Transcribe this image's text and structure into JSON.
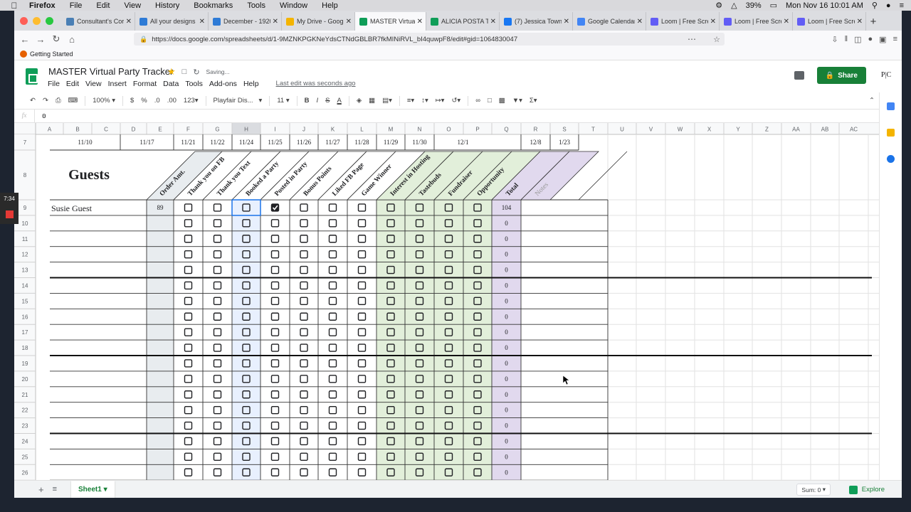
{
  "os_menubar": {
    "app": "Firefox",
    "menus": [
      "File",
      "Edit",
      "View",
      "History",
      "Bookmarks",
      "Tools",
      "Window",
      "Help"
    ],
    "battery": "39%",
    "datetime": "Mon Nov 16  10:01 AM"
  },
  "browser": {
    "tabs": [
      {
        "title": "Consultant's Cor",
        "color": "#4a7fb5",
        "active": false
      },
      {
        "title": "All your designs",
        "color": "#2e7bd6",
        "active": false
      },
      {
        "title": "December - 1920",
        "color": "#2e7bd6",
        "active": false
      },
      {
        "title": "My Drive - Googl",
        "color": "#f4b400",
        "active": false
      },
      {
        "title": "MASTER Virtual P",
        "color": "#0f9d58",
        "active": true
      },
      {
        "title": "ALICIA POSTA TH",
        "color": "#0f9d58",
        "active": false
      },
      {
        "title": "(7) Jessica Townl",
        "color": "#1877f2",
        "active": false
      },
      {
        "title": "Google Calendar",
        "color": "#4285f4",
        "active": false
      },
      {
        "title": "Loom | Free Scre",
        "color": "#625df5",
        "active": false
      },
      {
        "title": "Loom | Free Scre",
        "color": "#625df5",
        "active": false
      },
      {
        "title": "Loom | Free Scre",
        "color": "#625df5",
        "active": false
      }
    ],
    "url": "https://docs.google.com/spreadsheets/d/1-9MZNKPGKNeYdsCTNdGBLBR7fkMINiRVL_bI4quwpF8/edit#gid=1064830047",
    "bookmark": "Getting Started"
  },
  "doc": {
    "title": "MASTER Virtual Party Tracker",
    "status": "Saving...",
    "menus": [
      "File",
      "Edit",
      "View",
      "Insert",
      "Format",
      "Data",
      "Tools",
      "Add-ons",
      "Help"
    ],
    "last_edit": "Last edit was seconds ago",
    "share_label": "Share",
    "avatar_text": "P|C"
  },
  "toolbar": {
    "zoom": "100%",
    "currency": "$",
    "percent": "%",
    "dec_less": ".0",
    "dec_more": ".00",
    "more_formats": "123",
    "font": "Playfair Dis...",
    "font_size": "11",
    "bold": "B",
    "italic": "I",
    "strike": "S",
    "text_color": "A"
  },
  "formula_bar": {
    "fx": "fx",
    "value": "0"
  },
  "sheet": {
    "columns": [
      "A",
      "B",
      "C",
      "D",
      "E",
      "F",
      "G",
      "H",
      "I",
      "J",
      "K",
      "L",
      "M",
      "N",
      "O",
      "P",
      "Q",
      "R",
      "S",
      "T",
      "U",
      "V",
      "W",
      "X",
      "Y",
      "Z",
      "AA",
      "AB",
      "AC"
    ],
    "row_numbers": [
      "7",
      "8",
      "9",
      "10",
      "11",
      "12",
      "13",
      "14",
      "15",
      "16",
      "17",
      "18",
      "19",
      "20",
      "21",
      "22",
      "23",
      "24",
      "25",
      "26"
    ],
    "header_label": "Guests",
    "dates": [
      {
        "text": "11/10",
        "col": "B"
      },
      {
        "text": "11/17",
        "col": "E"
      },
      {
        "text": "11/21",
        "col": "F"
      },
      {
        "text": "11/22",
        "col": "G"
      },
      {
        "text": "11/24",
        "col": "H"
      },
      {
        "text": "11/25",
        "col": "I"
      },
      {
        "text": "11/26",
        "col": "J"
      },
      {
        "text": "11/27",
        "col": "K"
      },
      {
        "text": "11/28",
        "col": "L"
      },
      {
        "text": "11/29",
        "col": "M"
      },
      {
        "text": "11/30",
        "col": "N"
      },
      {
        "text": "12/1",
        "col": "OP"
      },
      {
        "text": "12/8",
        "col": "R"
      },
      {
        "text": "1/23",
        "col": "S"
      }
    ],
    "diagonal_headers": [
      "Order Amt.",
      "Thank you on FB",
      "Thank you Text",
      "Booked a Party",
      "Posted in Party",
      "Bonus Points",
      "Liked FB Page",
      "Game Winner",
      "Interest in Hosting",
      "Tastebuds",
      "Fundraiser",
      "Opportunity",
      "Total",
      "Notes"
    ],
    "guest_rows": [
      {
        "name": "Susie Guest",
        "order": "89",
        "checks": [
          false,
          false,
          false,
          true,
          false,
          false,
          false,
          false,
          false,
          false,
          false
        ],
        "total": "104"
      },
      {
        "name": "",
        "order": "",
        "checks": [],
        "total": "0"
      },
      {
        "name": "",
        "order": "",
        "checks": [],
        "total": "0"
      },
      {
        "name": "",
        "order": "",
        "checks": [],
        "total": "0"
      },
      {
        "name": "",
        "order": "",
        "checks": [],
        "total": "0"
      },
      {
        "name": "",
        "order": "",
        "checks": [],
        "total": "0"
      },
      {
        "name": "",
        "order": "",
        "checks": [],
        "total": "0"
      },
      {
        "name": "",
        "order": "",
        "checks": [],
        "total": "0"
      },
      {
        "name": "",
        "order": "",
        "checks": [],
        "total": "0"
      },
      {
        "name": "",
        "order": "",
        "checks": [],
        "total": "0"
      },
      {
        "name": "",
        "order": "",
        "checks": [],
        "total": "0"
      },
      {
        "name": "",
        "order": "",
        "checks": [],
        "total": "0"
      },
      {
        "name": "",
        "order": "",
        "checks": [],
        "total": "0"
      },
      {
        "name": "",
        "order": "",
        "checks": [],
        "total": "0"
      },
      {
        "name": "",
        "order": "",
        "checks": [],
        "total": "0"
      },
      {
        "name": "",
        "order": "",
        "checks": [],
        "total": "0"
      },
      {
        "name": "",
        "order": "",
        "checks": [],
        "total": "0"
      },
      {
        "name": "",
        "order": "",
        "checks": [],
        "total": "0"
      }
    ],
    "selected_col": "H",
    "colors": {
      "order_fill": "#e8ecef",
      "h_fill": "#e8f0fe",
      "green_fill": "#e2efda",
      "total_fill": "#e1d9ee",
      "notes_fill": "#e1d9ee"
    }
  },
  "bottom": {
    "sheet_name": "Sheet1",
    "sum": "Sum: 0",
    "explore": "Explore"
  },
  "recorder": {
    "time": "7:34"
  }
}
